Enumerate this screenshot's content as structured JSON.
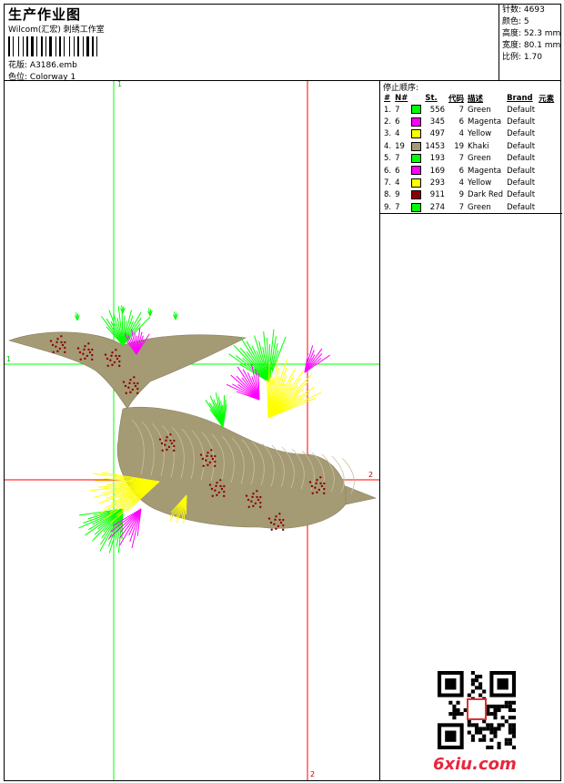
{
  "header": {
    "title": "生产作业图",
    "subtitle": "Wilcom(汇宏) 刺绣工作室",
    "design_label": "花版:",
    "design_value": "A3186.emb",
    "colorway_label": "色位:",
    "colorway_value": "Colorway 1"
  },
  "stats": {
    "stitches": "针数: 4693",
    "colors": "颜色: 5",
    "height": "高度: 52.3 mm",
    "width": "宽度: 80.1 mm",
    "scale": "比例: 1.70"
  },
  "stop_sequence": {
    "title": "停止顺序:",
    "headers": [
      "#",
      "N#",
      "",
      "St.",
      "代码",
      "描述",
      "Brand",
      "元素"
    ],
    "rows": [
      {
        "idx": "1.",
        "n": "7",
        "color": "#00ff00",
        "st": "556",
        "code": "7",
        "desc": "Green",
        "brand": "Default"
      },
      {
        "idx": "2.",
        "n": "6",
        "color": "#ff00ff",
        "st": "345",
        "code": "6",
        "desc": "Magenta",
        "brand": "Default"
      },
      {
        "idx": "3.",
        "n": "4",
        "color": "#ffff00",
        "st": "497",
        "code": "4",
        "desc": "Yellow",
        "brand": "Default"
      },
      {
        "idx": "4.",
        "n": "19",
        "color": "#a49a74",
        "st": "1453",
        "code": "19",
        "desc": "Khaki",
        "brand": "Default"
      },
      {
        "idx": "5.",
        "n": "7",
        "color": "#00ff00",
        "st": "193",
        "code": "7",
        "desc": "Green",
        "brand": "Default"
      },
      {
        "idx": "6.",
        "n": "6",
        "color": "#ff00ff",
        "st": "169",
        "code": "6",
        "desc": "Magenta",
        "brand": "Default"
      },
      {
        "idx": "7.",
        "n": "4",
        "color": "#ffff00",
        "st": "293",
        "code": "4",
        "desc": "Yellow",
        "brand": "Default"
      },
      {
        "idx": "8.",
        "n": "9",
        "color": "#8b0000",
        "st": "911",
        "code": "9",
        "desc": "Dark Red",
        "brand": "Default"
      },
      {
        "idx": "9.",
        "n": "7",
        "color": "#00ff00",
        "st": "274",
        "code": "7",
        "desc": "Green",
        "brand": "Default"
      }
    ]
  },
  "axes": {
    "v1_top": "1",
    "h1_left": "1",
    "h2_right": "2",
    "v2_bottom": "2"
  },
  "colors": {
    "green": "#00ff00",
    "red": "#ff0000",
    "khaki": "#a49a74",
    "magenta": "#ff00ff",
    "yellow": "#ffff00",
    "dark_red": "#8b0000"
  },
  "watermark": {
    "site": "6xiu.com",
    "qr_icon": "qr-code-icon"
  }
}
